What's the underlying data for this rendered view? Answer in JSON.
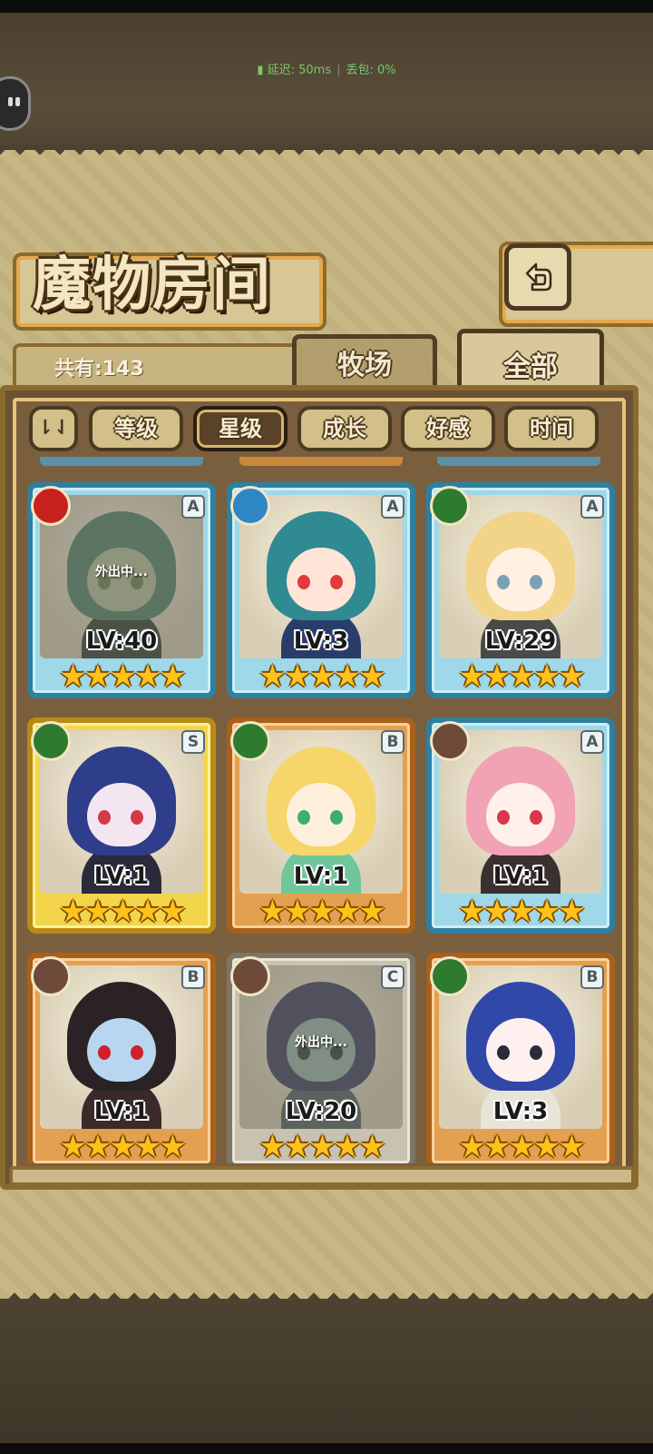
{
  "status": {
    "latency": "延迟: 50ms",
    "packet_loss": "丢包: 0%"
  },
  "title": "魔物房间",
  "count_label": "共有:143",
  "tabs": {
    "ranch": "牧场",
    "all": "全部"
  },
  "sort_toggle": "⇂⇃",
  "filters": [
    {
      "label": "等级",
      "active": false
    },
    {
      "label": "星级",
      "active": true
    },
    {
      "label": "成长",
      "active": false
    },
    {
      "label": "好感",
      "active": false
    },
    {
      "label": "时间",
      "active": false
    }
  ],
  "monsters": [
    {
      "element": "fire",
      "rank": "A",
      "level": "LV:40",
      "stars": "★★★★★",
      "status": "外出中...",
      "hair": "#5d8a74",
      "skin": "#b8c5a0",
      "body": "#3d4a40",
      "eye": "#6f8a5a"
    },
    {
      "element": "water",
      "rank": "A",
      "level": "LV:3",
      "stars": "★★★★★",
      "status": "",
      "hair": "#2f8a92",
      "skin": "#ffe4d8",
      "body": "#2a3d6a",
      "eye": "#e23a3a"
    },
    {
      "element": "wood",
      "rank": "A",
      "level": "LV:29",
      "stars": "★★★★★",
      "status": "",
      "hair": "#f2d488",
      "skin": "#fff0e2",
      "body": "#4a4a4a",
      "eye": "#7aa0b8"
    },
    {
      "element": "wood",
      "rank": "S",
      "level": "LV:1",
      "stars": "★★★★★",
      "status": "",
      "hair": "#2f3e8a",
      "skin": "#f4e6f0",
      "body": "#2a2a3a",
      "eye": "#d23a4a"
    },
    {
      "element": "wood",
      "rank": "B",
      "level": "LV:1",
      "stars": "★★★★★",
      "status": "",
      "hair": "#f6d56a",
      "skin": "#fff0dc",
      "body": "#6fc69a",
      "eye": "#3ab06a"
    },
    {
      "element": "earth",
      "rank": "A",
      "level": "LV:1",
      "stars": "★★★★★",
      "status": "",
      "hair": "#f1a2b4",
      "skin": "#fff0ea",
      "body": "#3a3030",
      "eye": "#d8384a"
    },
    {
      "element": "earth",
      "rank": "B",
      "level": "LV:1",
      "stars": "★★★★★",
      "status": "",
      "hair": "#2a2224",
      "skin": "#b8d6f0",
      "body": "#3a2a2a",
      "eye": "#d0202a"
    },
    {
      "element": "earth",
      "rank": "C",
      "level": "LV:20",
      "stars": "★★★★★",
      "status": "外出中...",
      "hair": "#4a4a6a",
      "skin": "#9fb8b0",
      "body": "#5a6a6a",
      "eye": "#3a4a4a"
    },
    {
      "element": "wood",
      "rank": "B",
      "level": "LV:3",
      "stars": "★★★★★",
      "status": "",
      "hair": "#3048a8",
      "skin": "#fff0f0",
      "body": "#e8e4d8",
      "eye": "#2a2a3a"
    }
  ],
  "element_colors": {
    "fire": "#c8221e",
    "water": "#2f86c4",
    "wood": "#2e7a2e",
    "earth": "#6e4a3a"
  },
  "element_icons": {
    "fire": "flame-icon",
    "water": "wave-icon",
    "wood": "leaf-icon",
    "earth": "mountain-icon"
  }
}
